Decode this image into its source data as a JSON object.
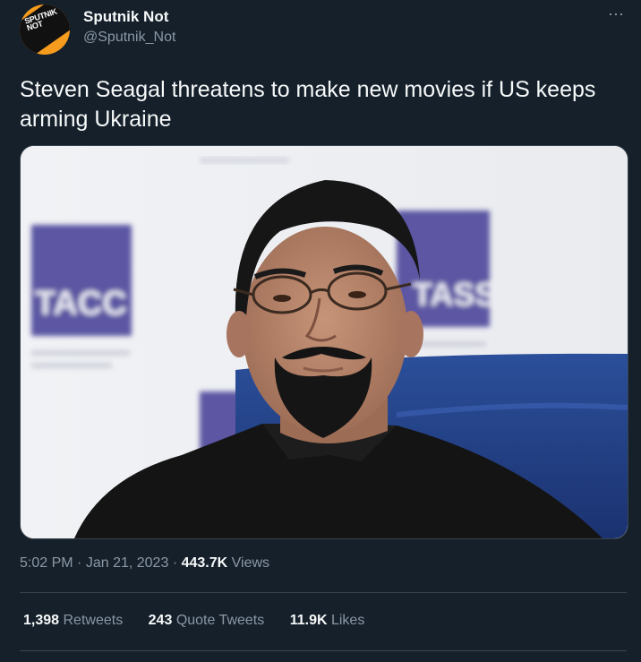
{
  "author": {
    "name": "Sputnik Not",
    "handle": "@Sputnik_Not",
    "avatar_text_line1": "SPUTNIK",
    "avatar_text_line2": "NOT"
  },
  "tweet": {
    "text": "Steven Seagal threatens to make new movies if US keeps arming Ukraine",
    "time": "5:02 PM",
    "date": "Jan 21, 2023",
    "views_count": "443.7K",
    "views_label": "Views"
  },
  "photo": {
    "backdrop_logo_left": "TACC",
    "backdrop_logo_right": "TASS"
  },
  "stats": {
    "retweets_count": "1,398",
    "retweets_label": "Retweets",
    "quotes_count": "243",
    "quotes_label": "Quote Tweets",
    "likes_count": "11.9K",
    "likes_label": "Likes"
  },
  "colors": {
    "background": "#15202b",
    "text_primary": "#f7f9f9",
    "text_secondary": "#8b98a5",
    "border": "#38444d",
    "avatar_brand": "#f59b1d"
  }
}
